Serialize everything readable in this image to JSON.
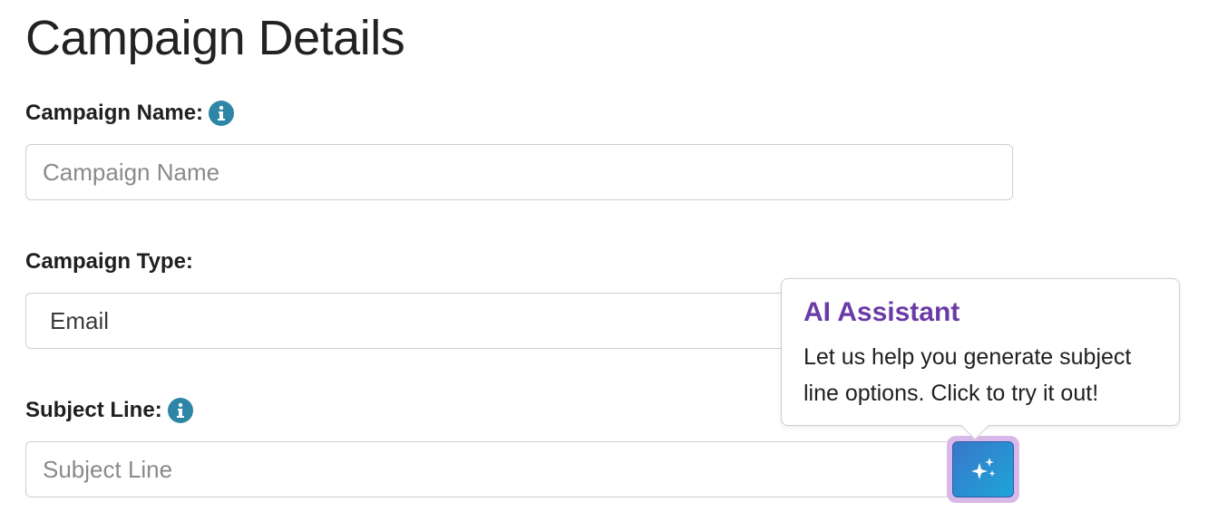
{
  "page": {
    "title": "Campaign Details"
  },
  "campaign_name": {
    "label": "Campaign Name:",
    "placeholder": "Campaign Name",
    "value": ""
  },
  "campaign_type": {
    "label": "Campaign Type:",
    "selected": "Email"
  },
  "subject_line": {
    "label": "Subject Line:",
    "placeholder": "Subject Line",
    "value": ""
  },
  "ai_tooltip": {
    "title": "AI Assistant",
    "body": "Let us help you generate subject line options. Click to try it out!"
  },
  "colors": {
    "info_icon": "#2e86a6",
    "tooltip_title": "#6a3aa6",
    "ai_button_from": "#3877c9",
    "ai_button_to": "#1ea5d8",
    "ai_button_glow": "#d8b8e8"
  },
  "icons": {
    "info": "info-icon",
    "ai": "sparkles-icon"
  }
}
